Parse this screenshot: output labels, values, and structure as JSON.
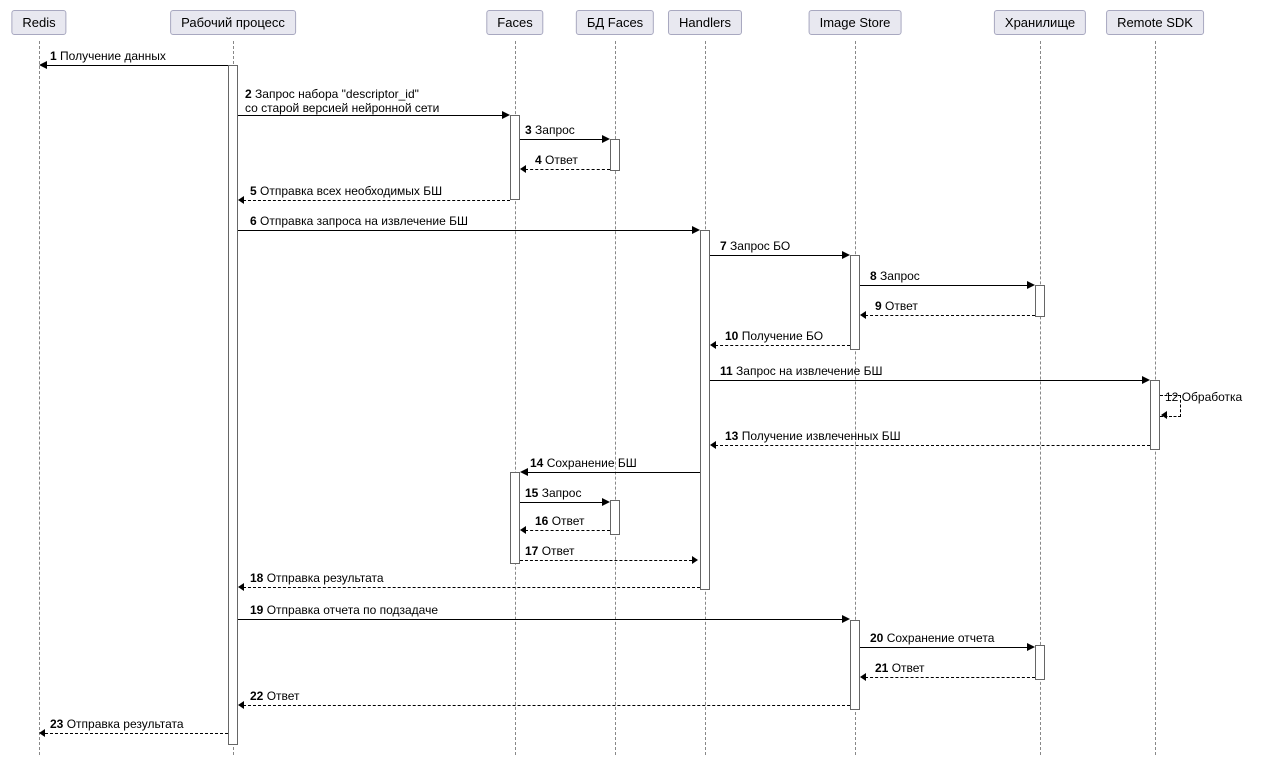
{
  "participants": {
    "redis": "Redis",
    "worker": "Рабочий процесс",
    "faces": "Faces",
    "facesdb": "БД Faces",
    "handlers": "Handlers",
    "imagestore": "Image Store",
    "storage": "Хранилище",
    "remotesdk": "Remote SDK"
  },
  "messages": {
    "m1": {
      "n": "1",
      "t": "Получение данных"
    },
    "m2": {
      "n": "2",
      "t": "Запрос набора \"descriptor_id\"\nсо старой версией нейронной сети"
    },
    "m2a": "Запрос набора \"descriptor_id\"",
    "m2b": "со старой версией нейронной сети",
    "m3": {
      "n": "3",
      "t": "Запрос"
    },
    "m4": {
      "n": "4",
      "t": "Ответ"
    },
    "m5": {
      "n": "5",
      "t": "Отправка всех необходимых БШ"
    },
    "m6": {
      "n": "6",
      "t": "Отправка запроса на извлечение БШ"
    },
    "m7": {
      "n": "7",
      "t": "Запрос БО"
    },
    "m8": {
      "n": "8",
      "t": "Запрос"
    },
    "m9": {
      "n": "9",
      "t": "Ответ"
    },
    "m10": {
      "n": "10",
      "t": "Получение БО"
    },
    "m11": {
      "n": "11",
      "t": "Запрос на извлечение БШ"
    },
    "m12": {
      "n": "12",
      "t": "Обработка"
    },
    "m13": {
      "n": "13",
      "t": "Получение извлеченных БШ"
    },
    "m14": {
      "n": "14",
      "t": "Сохранение БШ"
    },
    "m15": {
      "n": "15",
      "t": "Запрос"
    },
    "m16": {
      "n": "16",
      "t": "Ответ"
    },
    "m17": {
      "n": "17",
      "t": "Ответ"
    },
    "m18": {
      "n": "18",
      "t": "Отправка результата"
    },
    "m19": {
      "n": "19",
      "t": "Отправка отчета по подзадаче"
    },
    "m20": {
      "n": "20",
      "t": "Сохранение отчета"
    },
    "m21": {
      "n": "21",
      "t": "Ответ"
    },
    "m22": {
      "n": "22",
      "t": "Ответ"
    },
    "m23": {
      "n": "23",
      "t": "Отправка результата"
    }
  }
}
